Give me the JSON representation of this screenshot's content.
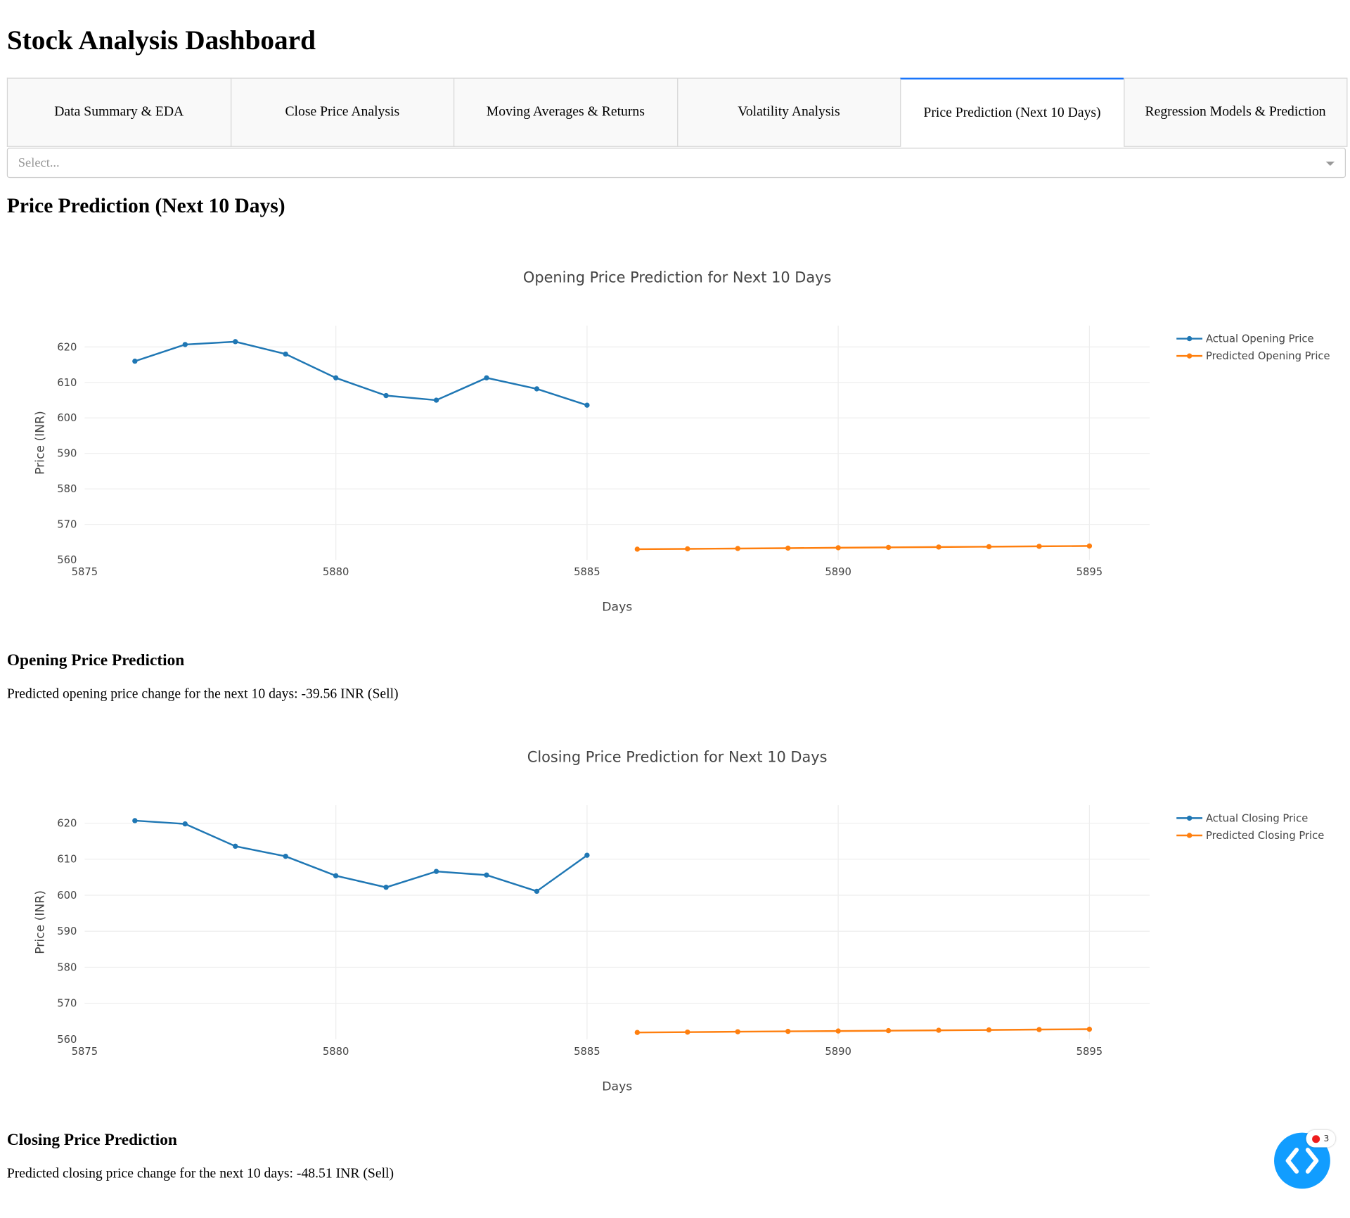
{
  "app_title": "Stock Analysis Dashboard",
  "tabs": [
    {
      "label": "Data Summary & EDA"
    },
    {
      "label": "Close Price Analysis"
    },
    {
      "label": "Moving Averages & Returns"
    },
    {
      "label": "Volatility Analysis"
    },
    {
      "label": "Price Prediction (Next 10 Days)",
      "active": true
    },
    {
      "label": "Regression Models & Prediction"
    }
  ],
  "dropdown": {
    "placeholder": "Select...",
    "value": ""
  },
  "section_title": "Price Prediction (Next 10 Days)",
  "opening": {
    "heading": "Opening Price Prediction",
    "text": "Predicted opening price change for the next 10 days: -39.56 INR (Sell)"
  },
  "closing": {
    "heading": "Closing Price Prediction",
    "text": "Predicted closing price change for the next 10 days: -48.51 INR (Sell)"
  },
  "colors": {
    "actual": "#1f77b4",
    "predicted": "#ff7f0e",
    "accent": "#1975fa",
    "fab": "#119dff"
  },
  "debug_badge": {
    "count": "3",
    "icon": "code-brackets-icon"
  },
  "chart_data": [
    {
      "type": "line",
      "title": "Opening Price Prediction for Next 10 Days",
      "xlabel": "Days",
      "ylabel": "Price (INR)",
      "xlim": [
        5875,
        5896.2
      ],
      "ylim": [
        560,
        626
      ],
      "xticks": [
        5875,
        5880,
        5885,
        5890,
        5895
      ],
      "yticks": [
        560,
        570,
        580,
        590,
        600,
        610,
        620
      ],
      "grid": true,
      "legend": "top-right",
      "series": [
        {
          "name": "Actual Opening Price",
          "color": "#1f77b4",
          "x": [
            5876,
            5877,
            5878,
            5879,
            5880,
            5881,
            5882,
            5883,
            5884,
            5885
          ],
          "y": [
            616.0,
            620.7,
            621.5,
            618.0,
            611.3,
            606.3,
            605.0,
            611.3,
            608.2,
            603.6
          ]
        },
        {
          "name": "Predicted Opening Price",
          "color": "#ff7f0e",
          "x": [
            5886,
            5887,
            5888,
            5889,
            5890,
            5891,
            5892,
            5893,
            5894,
            5895
          ],
          "y": [
            563.0,
            563.1,
            563.2,
            563.3,
            563.4,
            563.5,
            563.6,
            563.7,
            563.8,
            563.9
          ]
        }
      ]
    },
    {
      "type": "line",
      "title": "Closing Price Prediction for Next 10 Days",
      "xlabel": "Days",
      "ylabel": "Price (INR)",
      "xlim": [
        5875,
        5896.2
      ],
      "ylim": [
        560,
        625
      ],
      "xticks": [
        5875,
        5880,
        5885,
        5890,
        5895
      ],
      "yticks": [
        560,
        570,
        580,
        590,
        600,
        610,
        620
      ],
      "grid": true,
      "legend": "top-right",
      "series": [
        {
          "name": "Actual Closing Price",
          "color": "#1f77b4",
          "x": [
            5876,
            5877,
            5878,
            5879,
            5880,
            5881,
            5882,
            5883,
            5884,
            5885
          ],
          "y": [
            620.7,
            619.8,
            613.6,
            610.8,
            605.4,
            602.2,
            606.6,
            605.6,
            601.1,
            611.1
          ]
        },
        {
          "name": "Predicted Closing Price",
          "color": "#ff7f0e",
          "x": [
            5886,
            5887,
            5888,
            5889,
            5890,
            5891,
            5892,
            5893,
            5894,
            5895
          ],
          "y": [
            561.9,
            562.0,
            562.1,
            562.2,
            562.3,
            562.4,
            562.5,
            562.6,
            562.7,
            562.8
          ]
        }
      ]
    }
  ]
}
